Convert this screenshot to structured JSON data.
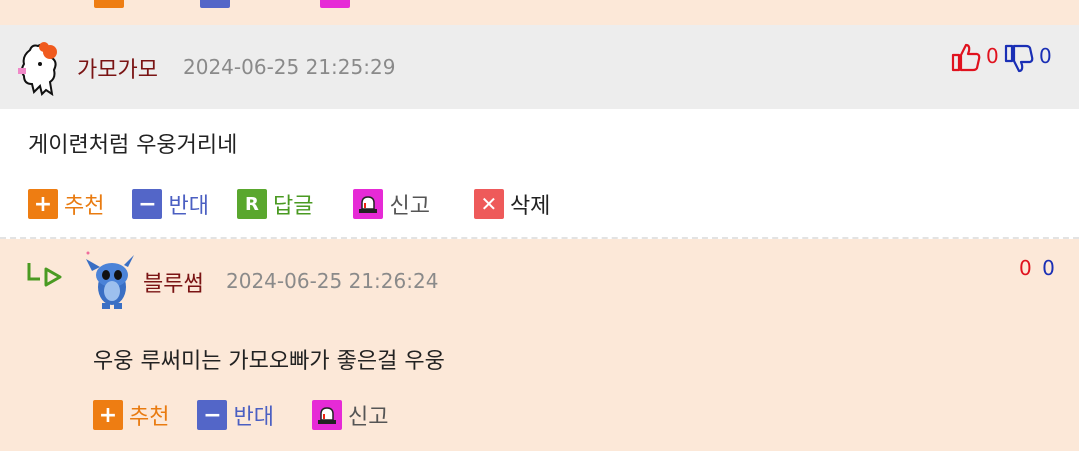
{
  "comments": [
    {
      "nickname": "가모가모",
      "date": "2024-06-25 21:25:29",
      "upvotes": "0",
      "downvotes": "0",
      "text": "게이련처럼 우웅거리네",
      "actions": {
        "recommend": "추천",
        "oppose": "반대",
        "reply": "답글",
        "report": "신고",
        "delete": "삭제"
      }
    },
    {
      "nickname": "블루썸",
      "date": "2024-06-25 21:26:24",
      "upvotes": "0",
      "downvotes": "0",
      "text": "우웅 루써미는 가모오빠가 좋은걸 우웅",
      "actions": {
        "recommend": "추천",
        "oppose": "반대",
        "report": "신고"
      }
    }
  ],
  "icons": {
    "recommend": "plus-icon",
    "oppose": "minus-icon",
    "reply": "reply-icon",
    "report": "siren-icon",
    "delete": "x-icon",
    "upvote": "thumbs-up-icon",
    "downvote": "thumbs-down-icon",
    "reply_arrow": "reply-arrow-icon"
  },
  "colors": {
    "nickname": "#7a1414",
    "upvote": "#e0121e",
    "downvote": "#1a2fb5",
    "recommend": "#ee7d12",
    "oppose": "#5366c8",
    "reply": "#5aa72e",
    "report": "#e62ad6",
    "delete": "#ee5a5a",
    "reply_bg": "#fce8d8",
    "header_bg": "#ededed"
  }
}
